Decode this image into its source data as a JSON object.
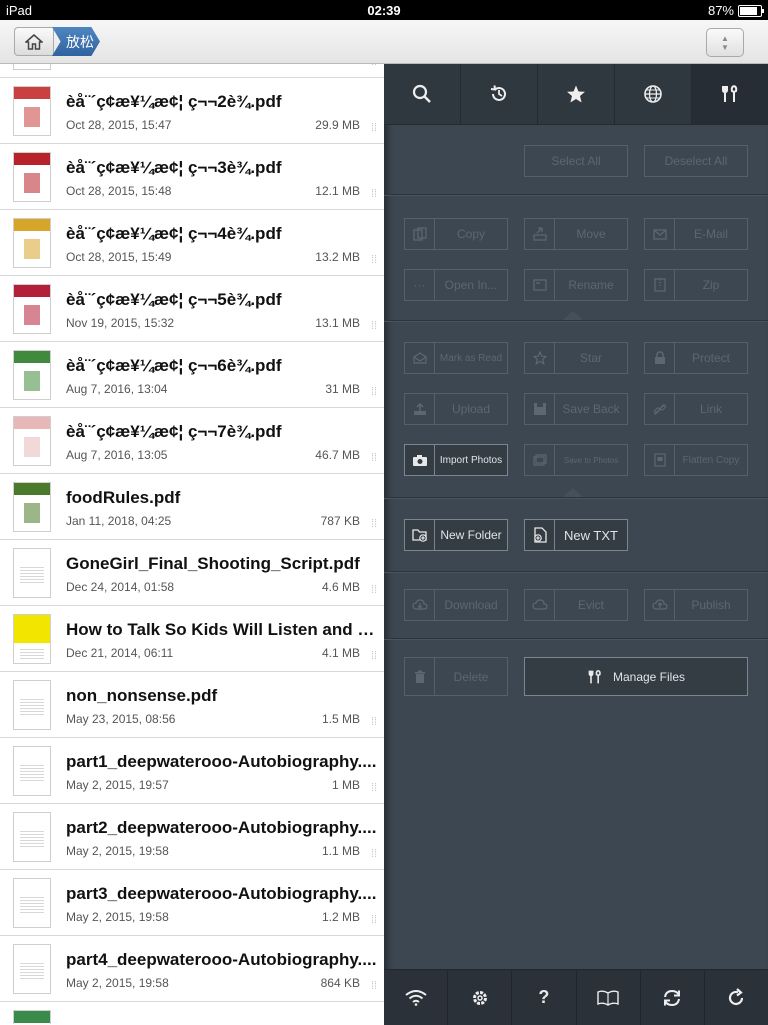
{
  "status": {
    "carrier": "iPad",
    "time": "02:39",
    "battery": "87%"
  },
  "navbar": {
    "current_folder": "放松"
  },
  "files": [
    {
      "name": "",
      "date": "",
      "size": "",
      "thumb_color": "#c94040"
    },
    {
      "name": "èå¨´ç¢æ¥¼æ¢¦ ç¬¬2è¾.pdf",
      "date": "Oct 28, 2015, 15:47",
      "size": "29.9 MB",
      "thumb_color": "#c94040"
    },
    {
      "name": "èå¨´ç¢æ¥¼æ¢¦ ç¬¬3è¾.pdf",
      "date": "Oct 28, 2015, 15:48",
      "size": "12.1 MB",
      "thumb_color": "#b8222a"
    },
    {
      "name": "èå¨´ç¢æ¥¼æ¢¦ ç¬¬4è¾.pdf",
      "date": "Oct 28, 2015, 15:49",
      "size": "13.2 MB",
      "thumb_color": "#d6a62a"
    },
    {
      "name": "èå¨´ç¢æ¥¼æ¢¦ ç¬¬5è¾.pdf",
      "date": "Nov 19, 2015, 15:32",
      "size": "13.1 MB",
      "thumb_color": "#b4203a"
    },
    {
      "name": "èå¨´ç¢æ¥¼æ¢¦ ç¬¬6è¾.pdf",
      "date": "Aug 7, 2016, 13:04",
      "size": "31 MB",
      "thumb_color": "#3f8a3c"
    },
    {
      "name": "èå¨´ç¢æ¥¼æ¢¦ ç¬¬7è¾.pdf",
      "date": "Aug 7, 2016, 13:05",
      "size": "46.7 MB",
      "thumb_color": "#e8b8b8"
    },
    {
      "name": "foodRules.pdf",
      "date": "Jan 11, 2018, 04:25",
      "size": "787 KB",
      "thumb_color": "#4a7a2a"
    },
    {
      "name": "GoneGirl_Final_Shooting_Script.pdf",
      "date": "Dec 24, 2014, 01:58",
      "size": "4.6 MB",
      "thumb_color": "#ffffff"
    },
    {
      "name": "How to Talk So Kids Will Listen and Li...",
      "date": "Dec 21, 2014, 06:11",
      "size": "4.1 MB",
      "thumb_color": "#f2e600"
    },
    {
      "name": "non_nonsense.pdf",
      "date": "May 23, 2015, 08:56",
      "size": "1.5 MB",
      "thumb_color": "#ffffff"
    },
    {
      "name": "part1_deepwaterooo-Autobiography....",
      "date": "May 2, 2015, 19:57",
      "size": "1 MB",
      "thumb_color": "#ffffff"
    },
    {
      "name": "part2_deepwaterooo-Autobiography....",
      "date": "May 2, 2015, 19:58",
      "size": "1.1 MB",
      "thumb_color": "#ffffff"
    },
    {
      "name": "part3_deepwaterooo-Autobiography....",
      "date": "May 2, 2015, 19:58",
      "size": "1.2 MB",
      "thumb_color": "#ffffff"
    },
    {
      "name": "part4_deepwaterooo-Autobiography....",
      "date": "May 2, 2015, 19:58",
      "size": "864 KB",
      "thumb_color": "#ffffff"
    },
    {
      "name": "",
      "date": "",
      "size": "",
      "thumb_color": "#3a8a4a"
    }
  ],
  "top_tabs": [
    {
      "name": "search",
      "icon": "search-icon"
    },
    {
      "name": "recent",
      "icon": "history-icon"
    },
    {
      "name": "favorites",
      "icon": "star-icon"
    },
    {
      "name": "network",
      "icon": "globe-icon"
    },
    {
      "name": "tools",
      "icon": "tools-icon"
    }
  ],
  "panel": {
    "select_all": "Select All",
    "deselect_all": "Deselect All",
    "copy": "Copy",
    "move": "Move",
    "email": "E-Mail",
    "open_in": "Open In...",
    "rename": "Rename",
    "zip": "Zip",
    "mark_as_read": "Mark as Read",
    "star": "Star",
    "protect": "Protect",
    "upload": "Upload",
    "save_back": "Save Back",
    "link": "Link",
    "import_photos": "Import Photos",
    "save_to_photos": "Save to Photos",
    "flatten_copy": "Flatten Copy",
    "new_folder": "New Folder",
    "new_txt": "New TXT",
    "download": "Download",
    "evict": "Evict",
    "publish": "Publish",
    "delete": "Delete",
    "manage_files": "Manage Files"
  },
  "bottom_bar": [
    {
      "name": "wifi",
      "icon": "wifi-icon"
    },
    {
      "name": "settings",
      "icon": "gear-icon"
    },
    {
      "name": "help",
      "icon": "question-icon"
    },
    {
      "name": "reader",
      "icon": "book-icon"
    },
    {
      "name": "sync",
      "icon": "sync-icon"
    },
    {
      "name": "refresh",
      "icon": "refresh-icon"
    }
  ]
}
